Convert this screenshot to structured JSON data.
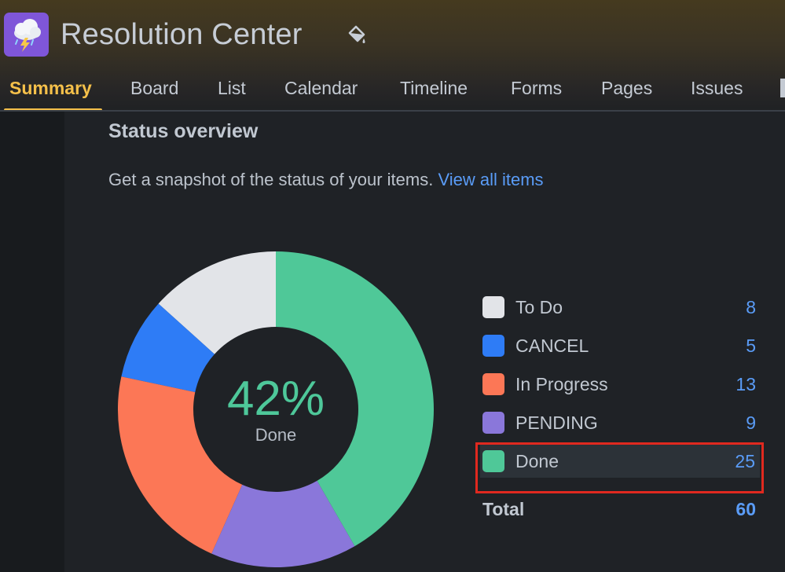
{
  "header": {
    "title": "Resolution Center",
    "app_icon": "storm-cloud-icon",
    "customize_icon": "paint-bucket-icon"
  },
  "tabs": [
    {
      "label": "Summary",
      "active": true
    },
    {
      "label": "Board",
      "active": false
    },
    {
      "label": "List",
      "active": false
    },
    {
      "label": "Calendar",
      "active": false
    },
    {
      "label": "Timeline",
      "active": false
    },
    {
      "label": "Forms",
      "active": false
    },
    {
      "label": "Pages",
      "active": false
    },
    {
      "label": "Issues",
      "active": false
    }
  ],
  "status_overview": {
    "title": "Status overview",
    "description": "Get a snapshot of the status of your items.",
    "link": "View all items",
    "center_value": "42%",
    "center_label": "Done",
    "total_label": "Total",
    "total_count": "60"
  },
  "chart_data": {
    "type": "pie",
    "categories": [
      "To Do",
      "CANCEL",
      "In Progress",
      "PENDING",
      "Done"
    ],
    "values": [
      8,
      5,
      13,
      9,
      25
    ],
    "colors": [
      "#e2e4e8",
      "#2e7cf6",
      "#fc7756",
      "#8a77da",
      "#4fc898"
    ],
    "total": 60
  },
  "legend": [
    {
      "label": "To Do",
      "count": "8",
      "color": "#e2e4e8"
    },
    {
      "label": "CANCEL",
      "count": "5",
      "color": "#2e7cf6"
    },
    {
      "label": "In Progress",
      "count": "13",
      "color": "#fc7756"
    },
    {
      "label": "PENDING",
      "count": "9",
      "color": "#8a77da"
    },
    {
      "label": "Done",
      "count": "25",
      "color": "#4fc898",
      "highlighted": true
    }
  ],
  "colors": {
    "accent": "#f5c04a",
    "link": "#5a9cf7",
    "highlight_border": "#e0291f"
  }
}
